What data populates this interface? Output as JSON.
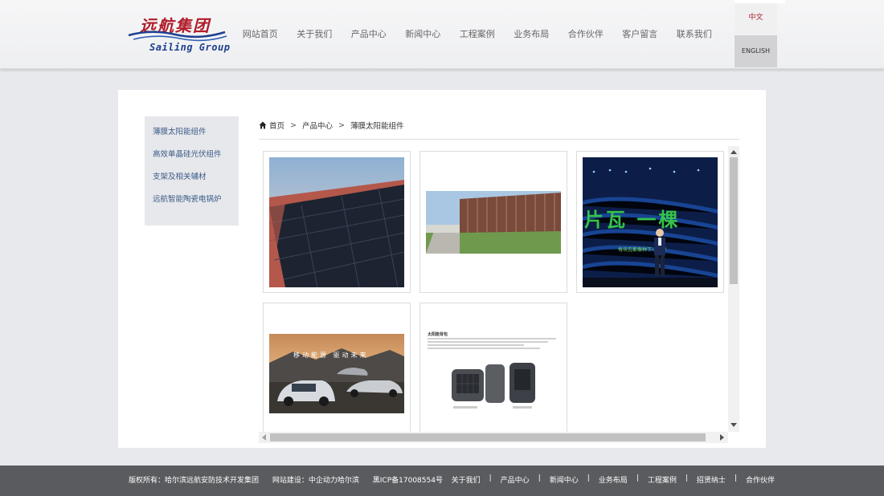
{
  "header": {
    "logo_cn": "远航集团",
    "logo_en": "Sailing Group",
    "nav": [
      "网站首页",
      "关于我们",
      "产品中心",
      "新闻中心",
      "工程案例",
      "业务布局",
      "合作伙伴",
      "客户留言",
      "联系我们"
    ],
    "lang_cn": "中文",
    "lang_en": "ENGLISH"
  },
  "sidebar": {
    "items": [
      "薄膜太阳能组件",
      "高效单晶硅光伏组件",
      "支架及相关辅材",
      "远航智能陶瓷电锅炉"
    ]
  },
  "breadcrumb": {
    "home": "首页",
    "sep": ">",
    "level1": "产品中心",
    "level2": "薄膜太阳能组件"
  },
  "products": {
    "p3_text": "片瓦 一棵",
    "p3_sub": "每块瓦都像种下一棵树",
    "p4_text": "移动能源 驱动未来",
    "p5_title": "太阳能背包"
  },
  "footer": {
    "copyright": "版权所有：哈尔滨远航安防技术开发集团",
    "builder": "网站建设：中企动力哈尔滨",
    "icp": "黑ICP备17008554号",
    "links": [
      "关于我们",
      "产品中心",
      "新闻中心",
      "业务布局",
      "工程案例",
      "招贤纳士",
      "合作伙伴"
    ],
    "sep": "|"
  },
  "colors": {
    "brand_red": "#b01c2a",
    "brand_blue": "#1d3f8f",
    "footer_bg": "#5a5b5e"
  }
}
